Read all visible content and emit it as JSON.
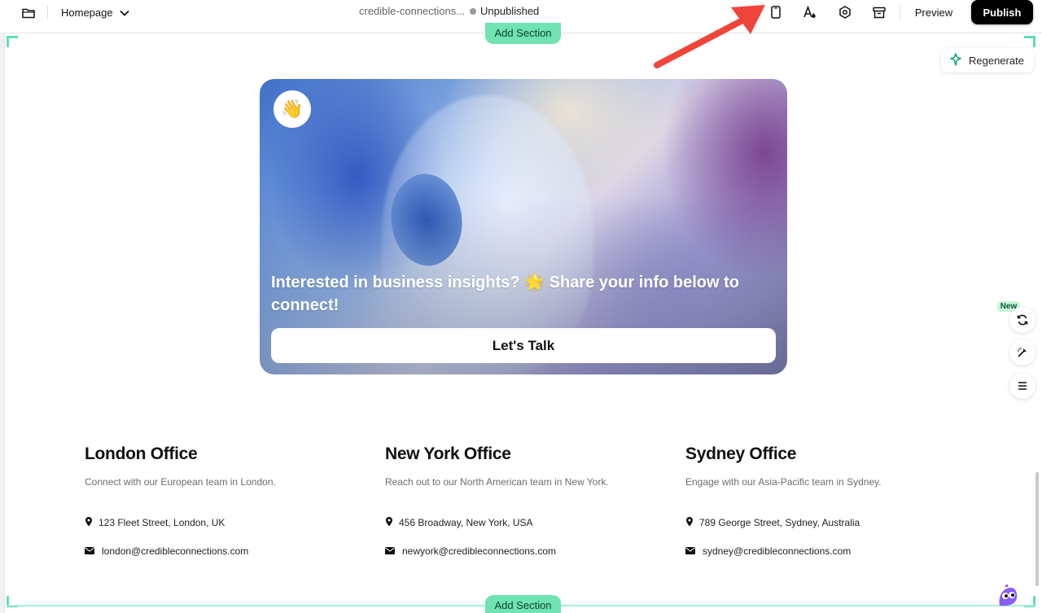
{
  "toolbar": {
    "page_name": "Homepage",
    "domain": "credible-connections...",
    "status": "Unpublished",
    "preview_label": "Preview",
    "publish_label": "Publish"
  },
  "editor": {
    "add_section_label": "Add Section",
    "regenerate_label": "Regenerate",
    "new_badge": "New",
    "accent_color": "#6fe3b1"
  },
  "hero": {
    "emoji": "👋",
    "headline": "Interested in business insights? 🌟 Share your info below to connect!",
    "button_label": "Let's Talk"
  },
  "offices": [
    {
      "title": "London Office",
      "description": "Connect with our European team in London.",
      "address": "123 Fleet Street, London, UK",
      "email": "london@credibleconnections.com"
    },
    {
      "title": "New York Office",
      "description": "Reach out to our North American team in New York.",
      "address": "456 Broadway, New York, USA",
      "email": "newyork@credibleconnections.com"
    },
    {
      "title": "Sydney Office",
      "description": "Engage with our Asia-Pacific team in Sydney.",
      "address": "789 George Street, Sydney, Australia",
      "email": "sydney@credibleconnections.com"
    }
  ]
}
